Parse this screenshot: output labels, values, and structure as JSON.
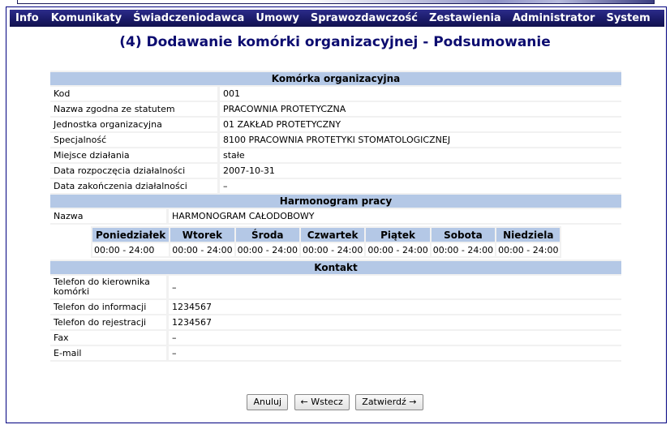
{
  "menu": {
    "items": [
      {
        "label": "Info"
      },
      {
        "label": "Komunikaty"
      },
      {
        "label": "Świadczeniodawca"
      },
      {
        "label": "Umowy"
      },
      {
        "label": "Sprawozdawczość"
      },
      {
        "label": "Zestawienia"
      },
      {
        "label": "Administrator"
      },
      {
        "label": "System"
      }
    ]
  },
  "page": {
    "title": "(4) Dodawanie komórki organizacyjnej - Podsumowanie"
  },
  "unit_section": {
    "header": "Komórka organizacyjna",
    "rows": [
      {
        "label": "Kod",
        "value": "001"
      },
      {
        "label": "Nazwa zgodna ze statutem",
        "value": "PRACOWNIA PROTETYCZNA"
      },
      {
        "label": "Jednostka organizacyjna",
        "value": "01 ZAKŁAD PROTETYCZNY"
      },
      {
        "label": "Specjalność",
        "value": "8100 PRACOWNIA PROTETYKI STOMATOLOGICZNEJ"
      },
      {
        "label": "Miejsce działania",
        "value": "stałe"
      },
      {
        "label": "Data rozpoczęcia działalności",
        "value": "2007-10-31"
      },
      {
        "label": "Data zakończenia działalności",
        "value": "–"
      }
    ]
  },
  "schedule_section": {
    "header": "Harmonogram pracy",
    "name_label": "Nazwa",
    "name_value": "HARMONOGRAM CAŁODOBOWY",
    "days": [
      "Poniedziałek",
      "Wtorek",
      "Środa",
      "Czwartek",
      "Piątek",
      "Sobota",
      "Niedziela"
    ],
    "hours": [
      "00:00 - 24:00",
      "00:00 - 24:00",
      "00:00 - 24:00",
      "00:00 - 24:00",
      "00:00 - 24:00",
      "00:00 - 24:00",
      "00:00 - 24:00"
    ]
  },
  "contact_section": {
    "header": "Kontakt",
    "rows": [
      {
        "label": "Telefon do kierownika komórki",
        "value": "–"
      },
      {
        "label": "Telefon do informacji",
        "value": "1234567"
      },
      {
        "label": "Telefon do rejestracji",
        "value": "1234567"
      },
      {
        "label": "Fax",
        "value": "–"
      },
      {
        "label": "E-mail",
        "value": "–"
      }
    ]
  },
  "buttons": {
    "cancel": "Anuluj",
    "back": "← Wstecz",
    "confirm": "Zatwierdź →"
  }
}
